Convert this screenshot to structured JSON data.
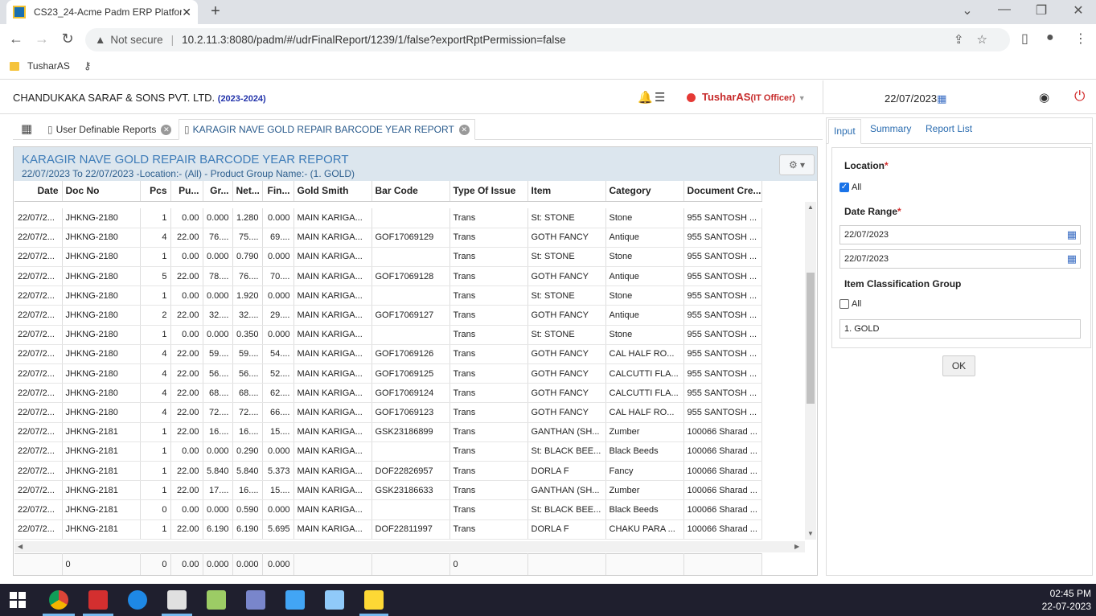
{
  "browser": {
    "tab_title": "CS23_24-Acme Padm ERP Platfor",
    "new_tab": "+",
    "address": {
      "not_secure": "Not secure",
      "url": "10.2.11.3:8080/padm/#/udrFinalReport/1239/1/false?exportRptPermission=false"
    },
    "bookmark": "TusharAS"
  },
  "header": {
    "company": "CHANDUKAKA SARAF & SONS PVT. LTD.",
    "year": "(2023-2024)",
    "user": "TusharAS",
    "role": "(IT Officer)",
    "date": "22/07/2023"
  },
  "report_tabs": [
    "User Definable Reports",
    "KARAGIR NAVE GOLD REPAIR BARCODE YEAR REPORT"
  ],
  "report": {
    "title": "KARAGIR NAVE GOLD REPAIR BARCODE YEAR REPORT",
    "subtitle": "22/07/2023 To 22/07/2023 -Location:- (All) - Product Group Name:- (1. GOLD)",
    "columns": [
      "Date",
      "Doc No",
      "Pcs",
      "Pu...",
      "Gr...",
      "Net...",
      "Fin...",
      "Gold Smith",
      "Bar Code",
      "Type Of Issue",
      "Item",
      "Category",
      "Document Cre..."
    ],
    "rows": [
      [
        "22/07/2...",
        "JHKNG-2180",
        "1",
        "0.00",
        "0.000",
        "1.280",
        "0.000",
        "MAIN KARIGA...",
        "",
        "Trans",
        "St: STONE",
        "Stone",
        "955 SANTOSH ..."
      ],
      [
        "22/07/2...",
        "JHKNG-2180",
        "4",
        "22.00",
        "76....",
        "75....",
        "69....",
        "MAIN KARIGA...",
        "GOF17069129",
        "Trans",
        "GOTH FANCY",
        "Antique",
        "955 SANTOSH ..."
      ],
      [
        "22/07/2...",
        "JHKNG-2180",
        "1",
        "0.00",
        "0.000",
        "0.790",
        "0.000",
        "MAIN KARIGA...",
        "",
        "Trans",
        "St: STONE",
        "Stone",
        "955 SANTOSH ..."
      ],
      [
        "22/07/2...",
        "JHKNG-2180",
        "5",
        "22.00",
        "78....",
        "76....",
        "70....",
        "MAIN KARIGA...",
        "GOF17069128",
        "Trans",
        "GOTH FANCY",
        "Antique",
        "955 SANTOSH ..."
      ],
      [
        "22/07/2...",
        "JHKNG-2180",
        "1",
        "0.00",
        "0.000",
        "1.920",
        "0.000",
        "MAIN KARIGA...",
        "",
        "Trans",
        "St: STONE",
        "Stone",
        "955 SANTOSH ..."
      ],
      [
        "22/07/2...",
        "JHKNG-2180",
        "2",
        "22.00",
        "32....",
        "32....",
        "29....",
        "MAIN KARIGA...",
        "GOF17069127",
        "Trans",
        "GOTH FANCY",
        "Antique",
        "955 SANTOSH ..."
      ],
      [
        "22/07/2...",
        "JHKNG-2180",
        "1",
        "0.00",
        "0.000",
        "0.350",
        "0.000",
        "MAIN KARIGA...",
        "",
        "Trans",
        "St: STONE",
        "Stone",
        "955 SANTOSH ..."
      ],
      [
        "22/07/2...",
        "JHKNG-2180",
        "4",
        "22.00",
        "59....",
        "59....",
        "54....",
        "MAIN KARIGA...",
        "GOF17069126",
        "Trans",
        "GOTH FANCY",
        "CAL HALF RO...",
        "955 SANTOSH ..."
      ],
      [
        "22/07/2...",
        "JHKNG-2180",
        "4",
        "22.00",
        "56....",
        "56....",
        "52....",
        "MAIN KARIGA...",
        "GOF17069125",
        "Trans",
        "GOTH FANCY",
        "CALCUTTI FLA...",
        "955 SANTOSH ..."
      ],
      [
        "22/07/2...",
        "JHKNG-2180",
        "4",
        "22.00",
        "68....",
        "68....",
        "62....",
        "MAIN KARIGA...",
        "GOF17069124",
        "Trans",
        "GOTH FANCY",
        "CALCUTTI FLA...",
        "955 SANTOSH ..."
      ],
      [
        "22/07/2...",
        "JHKNG-2180",
        "4",
        "22.00",
        "72....",
        "72....",
        "66....",
        "MAIN KARIGA...",
        "GOF17069123",
        "Trans",
        "GOTH FANCY",
        "CAL HALF RO...",
        "955 SANTOSH ..."
      ],
      [
        "22/07/2...",
        "JHKNG-2181",
        "1",
        "22.00",
        "16....",
        "16....",
        "15....",
        "MAIN KARIGA...",
        "GSK23186899",
        "Trans",
        "GANTHAN (SH...",
        "Zumber",
        "100066 Sharad ..."
      ],
      [
        "22/07/2...",
        "JHKNG-2181",
        "1",
        "0.00",
        "0.000",
        "0.290",
        "0.000",
        "MAIN KARIGA...",
        "",
        "Trans",
        "St: BLACK BEE...",
        "Black Beeds",
        "100066 Sharad ..."
      ],
      [
        "22/07/2...",
        "JHKNG-2181",
        "1",
        "22.00",
        "5.840",
        "5.840",
        "5.373",
        "MAIN KARIGA...",
        "DOF22826957",
        "Trans",
        "DORLA F",
        "Fancy",
        "100066 Sharad ..."
      ],
      [
        "22/07/2...",
        "JHKNG-2181",
        "1",
        "22.00",
        "17....",
        "16....",
        "15....",
        "MAIN KARIGA...",
        "GSK23186633",
        "Trans",
        "GANTHAN (SH...",
        "Zumber",
        "100066 Sharad ..."
      ],
      [
        "22/07/2...",
        "JHKNG-2181",
        "0",
        "0.00",
        "0.000",
        "0.590",
        "0.000",
        "MAIN KARIGA...",
        "",
        "Trans",
        "St: BLACK BEE...",
        "Black Beeds",
        "100066 Sharad ..."
      ],
      [
        "22/07/2...",
        "JHKNG-2181",
        "1",
        "22.00",
        "6.190",
        "6.190",
        "5.695",
        "MAIN KARIGA...",
        "DOF22811997",
        "Trans",
        "DORLA F",
        "CHAKU PARA ...",
        "100066 Sharad ..."
      ]
    ],
    "footer": [
      "",
      "0",
      "0",
      "0.00",
      "0.000",
      "0.000",
      "0.000",
      "",
      "",
      "0",
      "",
      "",
      ""
    ]
  },
  "side": {
    "tabs": [
      "Input",
      "Summary",
      "Report List"
    ],
    "location_label": "Location",
    "location_all": "All",
    "location_all_checked": true,
    "date_range_label": "Date Range",
    "date_from": "22/07/2023",
    "date_to": "22/07/2023",
    "item_group_label": "Item Classification Group",
    "item_group_all": "All",
    "item_group_all_checked": false,
    "item_group_value": "1. GOLD",
    "ok": "OK"
  },
  "taskbar": {
    "time": "02:45 PM",
    "date": "22-07-2023"
  },
  "colors": {
    "accent": "#3e7cb8",
    "header_bg": "#dce6ee",
    "user": "#c62828",
    "taskbar": "#1f1f2e"
  }
}
